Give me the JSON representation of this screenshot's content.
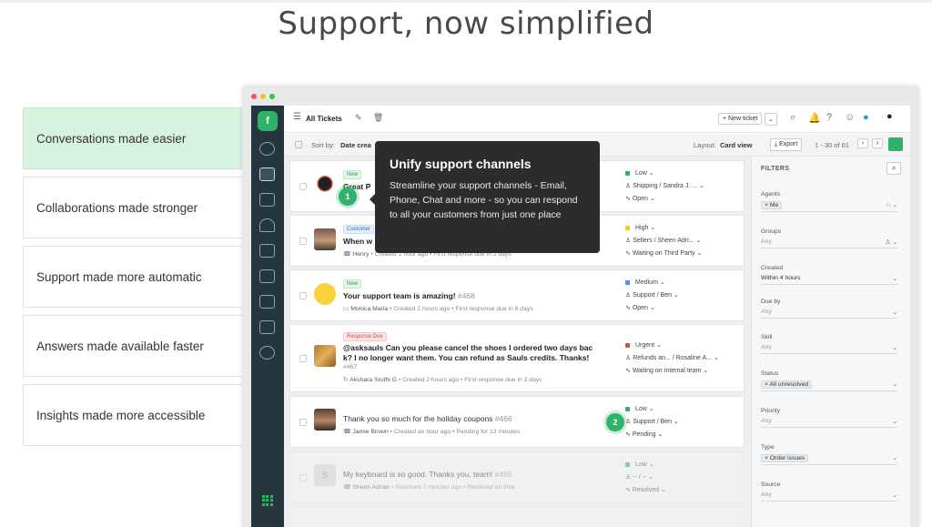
{
  "page": {
    "title": "Support, now simplified"
  },
  "features": [
    {
      "label": "Conversations made easier",
      "active": true
    },
    {
      "label": "Collaborations made stronger",
      "active": false
    },
    {
      "label": "Support made more automatic",
      "active": false
    },
    {
      "label": "Answers made available faster",
      "active": false
    },
    {
      "label": "Insights made more accessible",
      "active": false
    }
  ],
  "colors": {
    "accent": "#2fb36a",
    "nav_bg": "#24373f",
    "tooltip_bg": "#2c2c2c",
    "active_feature_bg": "#d6f3df"
  },
  "toolbar": {
    "view_title": "All Tickets",
    "new_ticket": "+ New ticket",
    "sort_label": "Sort by:",
    "sort_value": "Date crea",
    "layout_label": "Layout:",
    "layout_value": "Card view",
    "export": "Export",
    "pagination": "1 - 30 of 61"
  },
  "tooltip": {
    "title": "Unify support channels",
    "body": "Streamline your support channels - Email, Phone, Chat and more - so you can respond to all your customers from just one place"
  },
  "badges": [
    "1",
    "2"
  ],
  "tickets": [
    {
      "tag": "New",
      "subject": "Great P",
      "meta_name": "",
      "meta_rest": "",
      "priority": "Low",
      "priority_color": "#2fb36a",
      "group": "Shipping / Sandra J. ...",
      "status": "Open",
      "avatar": "hat"
    },
    {
      "tag": "Customer",
      "subject": "When w",
      "meta_name": "Henry",
      "meta_rest": "• Created 1 hour ago • First response due in 2 days",
      "priority": "High",
      "priority_color": "#f5c518",
      "group": "Sellers / Sheen Adri...",
      "status": "Waiting on Third Party",
      "avatar": "man1"
    },
    {
      "tag": "New",
      "subject": "Your support team is amazing!",
      "id": "#468",
      "meta_name": "Monica Maria",
      "meta_rest": "• Created 2 hours ago • First response due in 6 days",
      "priority": "Medium",
      "priority_color": "#4a8fe0",
      "group": "Support / Ben",
      "status": "Open",
      "avatar": "emoji"
    },
    {
      "tag": "Response Due",
      "subject": "@asksauls Can you please cancel the shoes I ordered two days bac",
      "subject2": "k? I no longer want them. You can refund as Sauls credits. Thanks!",
      "id": "#467",
      "meta_name": "Akshara Sruthi G",
      "meta_rest": "• Created 2 hours ago • First response due in 2 days",
      "priority": "Urgent",
      "priority_color": "#e0483e",
      "group": "Refunds an... / Rosaline A...",
      "status": "Waiting on Internal team",
      "avatar": "food"
    },
    {
      "tag": "",
      "subject": "Thank you so much for the holiday coupons",
      "id": "#466",
      "meta_name": "Jamie Brown",
      "meta_rest": "• Created an hour ago • Pending for 13 minutes",
      "priority": "Low",
      "priority_color": "#2fb36a",
      "group": "Support / Ben",
      "status": "Pending",
      "avatar": "man2"
    },
    {
      "tag": "",
      "subject": "My keyboard is so good. Thanks you, team!",
      "id": "#465",
      "meta_name": "Sheen Adrian",
      "meta_rest": "• Resolved 7 minutes ago • Resolved on time",
      "priority": "Low",
      "priority_color": "#2fb36a",
      "group": "-- / --",
      "status": "Resolved",
      "avatar": "letter"
    }
  ],
  "filters": {
    "heading": "FILTERS",
    "agents_label": "Agents",
    "agents_value": "Me",
    "groups_label": "Groups",
    "groups_value": "Any",
    "created_label": "Created",
    "created_value": "Within 4 hours",
    "due_label": "Due by",
    "due_value": "Any",
    "skill_label": "Skill",
    "skill_value": "Any",
    "status_label": "Status",
    "status_value": "All unresolved",
    "priority_label": "Priority",
    "priority_value": "Any",
    "type_label": "Type",
    "type_value": "Order issues",
    "source_label": "Source",
    "source_value": "Any"
  }
}
